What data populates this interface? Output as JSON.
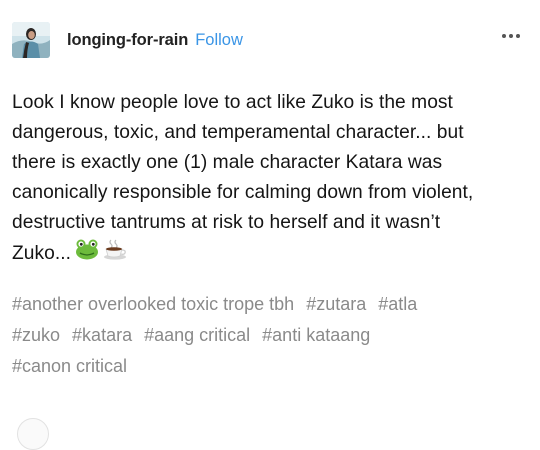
{
  "post": {
    "username": "longing-for-rain",
    "follow_label": "Follow",
    "body_lines": [
      "Look I know people love to act like Zuko is the most",
      "dangerous, toxic, and temperamental character... but",
      "there is exactly one (1) male character Katara was",
      "canonically responsible for calming down from violent,",
      "destructive tantrums at risk to herself and it wasn’t",
      "Zuko..."
    ],
    "emojis": [
      "frog-emoji",
      "coffee-emoji"
    ],
    "tags_lines": [
      [
        "#another overlooked toxic trope tbh",
        "#zutara",
        "#atla"
      ],
      [
        "#zuko",
        "#katara",
        "#aang critical",
        "#anti kataang"
      ],
      [
        "#canon critical"
      ]
    ]
  },
  "colors": {
    "follow": "#3a95e6",
    "text": "#151515",
    "tags": "#8a8a8a"
  }
}
